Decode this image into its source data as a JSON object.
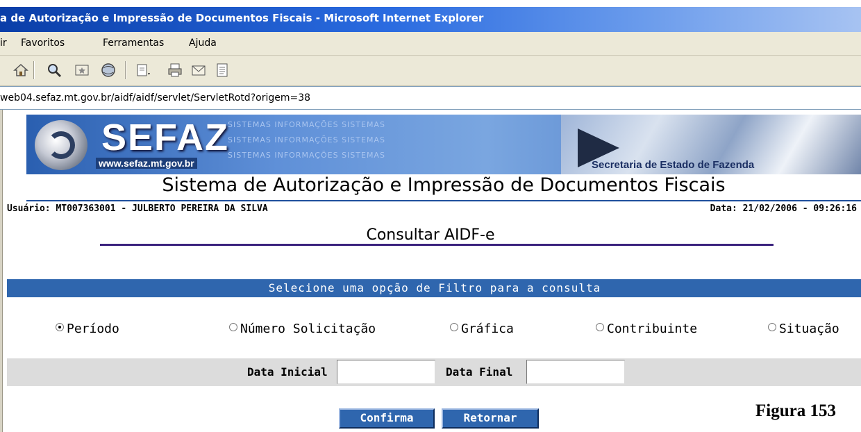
{
  "window": {
    "title": "a de Autorização e Impressão de Documentos Fiscais - Microsoft Internet Explorer"
  },
  "menu": {
    "items": [
      "ir",
      "Favoritos",
      "Ferramentas",
      "Ajuda"
    ]
  },
  "toolbar": {
    "icons": [
      "home-icon",
      "search-icon",
      "favorites-icon",
      "media-icon",
      "edit-icon",
      "print-icon",
      "mail-icon",
      "page-icon"
    ]
  },
  "address": {
    "url": "web04.sefaz.mt.gov.br/aidf/aidf/servlet/ServletRotd?origem=38"
  },
  "banner": {
    "brand": "SEFAZ",
    "brand_url": "www.sefaz.mt.gov.br",
    "tagline": "SISTEMAS  INFORMAÇÕES  SISTEMAS",
    "caption": "Secretaria de Estado de Fazenda"
  },
  "app_title": "Sistema de Autorização e Impressão de Documentos Fiscais",
  "user_line": "Usuário: MT007363001 - JULBERTO PEREIRA DA SILVA",
  "date_line": "Data: 21/02/2006 - 09:26:16",
  "page_title": "Consultar AIDF-e",
  "filter": {
    "heading": "Selecione uma opção de Filtro para a consulta",
    "options": [
      {
        "label": "Período",
        "checked": true
      },
      {
        "label": "Número Solicitação",
        "checked": false
      },
      {
        "label": "Gráfica",
        "checked": false
      },
      {
        "label": "Contribuinte",
        "checked": false
      },
      {
        "label": "Situação",
        "checked": false
      }
    ]
  },
  "date_fields": {
    "start_label": "Data Inicial",
    "start_value": "",
    "end_label": "Data Final",
    "end_value": ""
  },
  "buttons": {
    "confirm": "Confirma",
    "back": "Retornar"
  },
  "figure_caption": "Figura 153",
  "colors": {
    "accent_blue": "#2f66ae",
    "rule_purple": "#3b237e",
    "title_bar": "#0a3ea8"
  }
}
